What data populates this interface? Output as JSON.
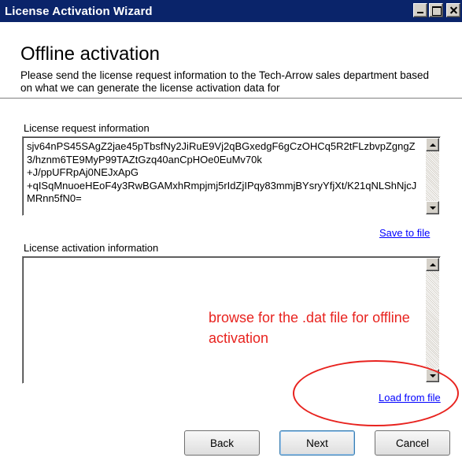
{
  "window": {
    "title": "License Activation Wizard"
  },
  "header": {
    "title": "Offline activation",
    "description": "Please send the license request information to the Tech-Arrow sales department based on what we can generate the license activation data for"
  },
  "request": {
    "label": "License request information",
    "value": "sjv64nPS45SAgZ2jae45pTbsfNy2JiRuE9Vj2qBGxedgF6gCzOHCq5R2tFLzbvpZgngZ3/hznm6TE9MyP99TAZtGzq40anCpHOe0EuMv70k\n+J/ppUFRpAj0NEJxApG\n+qISqMnuoeHEoF4y3RwBGAMxhRmpjmj5rIdZjIPqy83mmjBYsryYfjXt/K21qNLShNjcJMRnn5fN0=",
    "save_link": "Save to file"
  },
  "activation": {
    "label": "License activation information",
    "value": "",
    "load_link": "Load from file"
  },
  "annotation": {
    "text": "browse for the .dat file for offline activation",
    "color": "#e8231f"
  },
  "buttons": {
    "back": "Back",
    "next": "Next",
    "cancel": "Cancel"
  },
  "colors": {
    "titlebar": "#0a246a",
    "link": "#0000ff"
  }
}
